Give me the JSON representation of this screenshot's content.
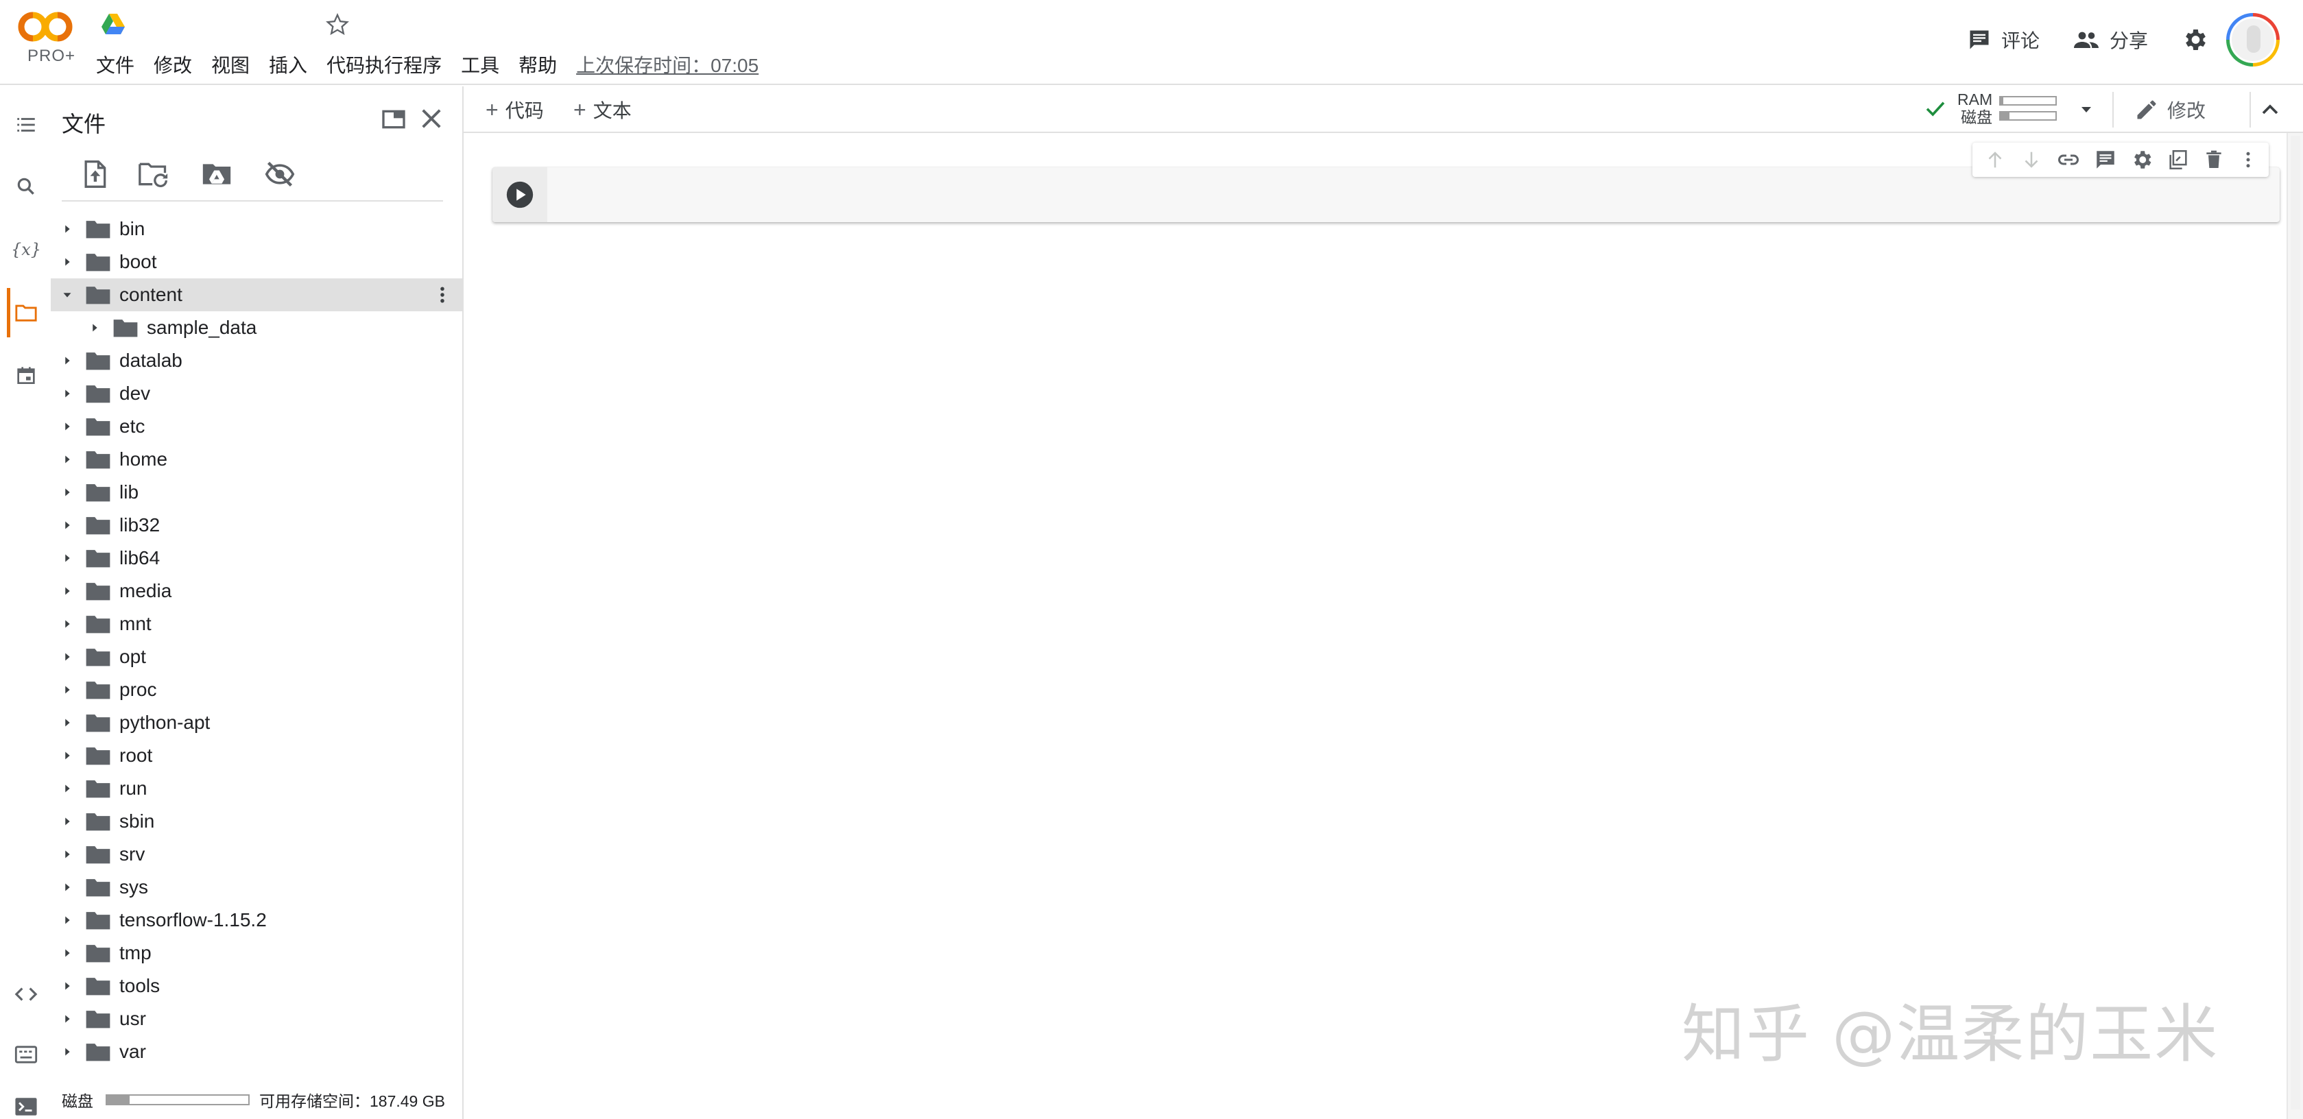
{
  "header": {
    "logo_text": "PRO+",
    "menu": [
      "文件",
      "修改",
      "视图",
      "插入",
      "代码执行程序",
      "工具",
      "帮助"
    ],
    "last_saved": "上次保存时间：07:05",
    "comment_label": "评论",
    "share_label": "分享"
  },
  "sidebar": {
    "icons": [
      "toc-icon",
      "search-icon",
      "variables-icon",
      "folder-icon",
      "calendar-icon",
      "code-snippets-icon",
      "command-palette-icon",
      "terminal-icon"
    ],
    "variables_symbol": "{x}"
  },
  "files_panel": {
    "title": "文件",
    "toolbar": [
      "upload-file-icon",
      "refresh-folder-icon",
      "mount-drive-icon",
      "hide-files-icon"
    ],
    "tree": [
      {
        "name": "bin",
        "level": 0,
        "expanded": false
      },
      {
        "name": "boot",
        "level": 0,
        "expanded": false
      },
      {
        "name": "content",
        "level": 0,
        "expanded": true,
        "selected": true
      },
      {
        "name": "sample_data",
        "level": 1,
        "expanded": false
      },
      {
        "name": "datalab",
        "level": 0,
        "expanded": false
      },
      {
        "name": "dev",
        "level": 0,
        "expanded": false
      },
      {
        "name": "etc",
        "level": 0,
        "expanded": false
      },
      {
        "name": "home",
        "level": 0,
        "expanded": false
      },
      {
        "name": "lib",
        "level": 0,
        "expanded": false
      },
      {
        "name": "lib32",
        "level": 0,
        "expanded": false
      },
      {
        "name": "lib64",
        "level": 0,
        "expanded": false
      },
      {
        "name": "media",
        "level": 0,
        "expanded": false
      },
      {
        "name": "mnt",
        "level": 0,
        "expanded": false
      },
      {
        "name": "opt",
        "level": 0,
        "expanded": false
      },
      {
        "name": "proc",
        "level": 0,
        "expanded": false
      },
      {
        "name": "python-apt",
        "level": 0,
        "expanded": false
      },
      {
        "name": "root",
        "level": 0,
        "expanded": false
      },
      {
        "name": "run",
        "level": 0,
        "expanded": false
      },
      {
        "name": "sbin",
        "level": 0,
        "expanded": false
      },
      {
        "name": "srv",
        "level": 0,
        "expanded": false
      },
      {
        "name": "sys",
        "level": 0,
        "expanded": false
      },
      {
        "name": "tensorflow-1.15.2",
        "level": 0,
        "expanded": false
      },
      {
        "name": "tmp",
        "level": 0,
        "expanded": false
      },
      {
        "name": "tools",
        "level": 0,
        "expanded": false
      },
      {
        "name": "usr",
        "level": 0,
        "expanded": false
      },
      {
        "name": "var",
        "level": 0,
        "expanded": false
      }
    ],
    "footer": {
      "disk_label": "磁盘",
      "disk_usage_fraction": 0.16,
      "available_text": "可用存储空间：187.49 GB"
    }
  },
  "notebook": {
    "add_code_label": "代码",
    "add_text_label": "文本",
    "resources": {
      "ram_label": "RAM",
      "disk_label": "磁盘",
      "ram_usage_fraction": 0.05,
      "disk_usage_fraction": 0.16
    },
    "edit_label": "修改",
    "cell_tools": [
      "move-up-icon",
      "move-down-icon",
      "link-icon",
      "comment-icon",
      "settings-icon",
      "mirror-cell-icon",
      "delete-icon",
      "more-icon"
    ]
  },
  "watermark": "知乎 @温柔的玉米",
  "colors": {
    "accent_orange": "#e8710a",
    "connected_green": "#1e8e3e",
    "icon_gray": "#5f6368",
    "folder_gray": "#5f6368",
    "selected_row": "#e0e0e0"
  }
}
